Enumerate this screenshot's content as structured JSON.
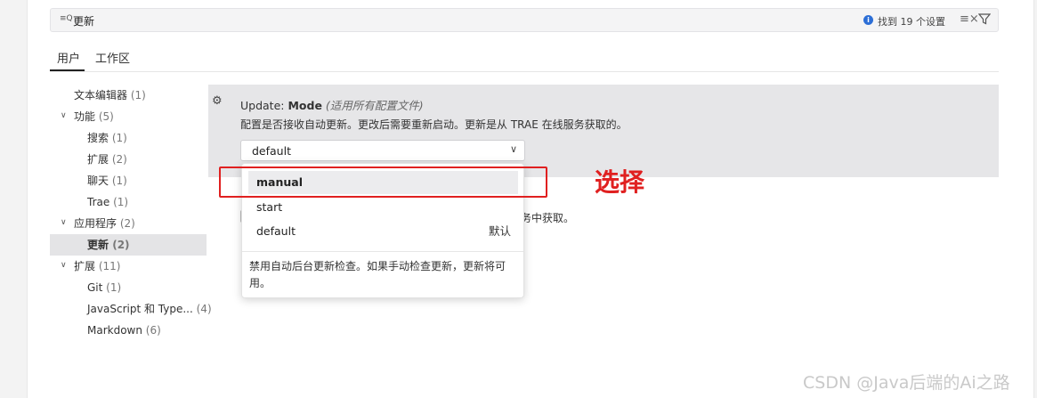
{
  "search": {
    "icon": "search-icon",
    "value": "更新",
    "result_text": "找到 19 个设置",
    "clear_icon": "clear-filter-icon",
    "filter_icon": "filter-icon"
  },
  "tabs": [
    {
      "label": "用户",
      "selected": true
    },
    {
      "label": "工作区",
      "selected": false
    }
  ],
  "sidebar": {
    "items": [
      {
        "label": "文本编辑器",
        "count": "(1)"
      },
      {
        "label": "功能",
        "count": "(5)",
        "expanded": true
      },
      {
        "label": "搜索",
        "count": "(1)"
      },
      {
        "label": "扩展",
        "count": "(2)"
      },
      {
        "label": "聊天",
        "count": "(1)"
      },
      {
        "label": "Trae",
        "count": "(1)"
      },
      {
        "label": "应用程序",
        "count": "(2)",
        "expanded": true
      },
      {
        "label": "更新",
        "count": "(2)",
        "selected": true
      },
      {
        "label": "扩展",
        "count": "(11)",
        "expanded": true
      },
      {
        "label": "Git",
        "count": "(1)"
      },
      {
        "label": "JavaScript 和 Type...",
        "count": "(4)"
      },
      {
        "label": "Markdown",
        "count": "(6)"
      }
    ]
  },
  "setting": {
    "title_prefix": "Update:",
    "title_name": "Mode",
    "scope": "(适用所有配置文件)",
    "description": "配置是否接收自动更新。更改后需要重新启动。更新是从 TRAE 在线服务获取的。",
    "selected_value": "default",
    "hidden_row_tail": "务中获取。"
  },
  "dropdown": {
    "options": [
      {
        "label": "manual",
        "highlighted": true,
        "tag": ""
      },
      {
        "label": "start",
        "highlighted": false,
        "tag": ""
      },
      {
        "label": "default",
        "highlighted": false,
        "tag": "默认"
      }
    ],
    "description": "禁用自动后台更新检查。如果手动检查更新，更新将可用。"
  },
  "annotation": {
    "text": "选择",
    "color": "#e02020"
  },
  "watermark": "CSDN @Java后端的Ai之路"
}
